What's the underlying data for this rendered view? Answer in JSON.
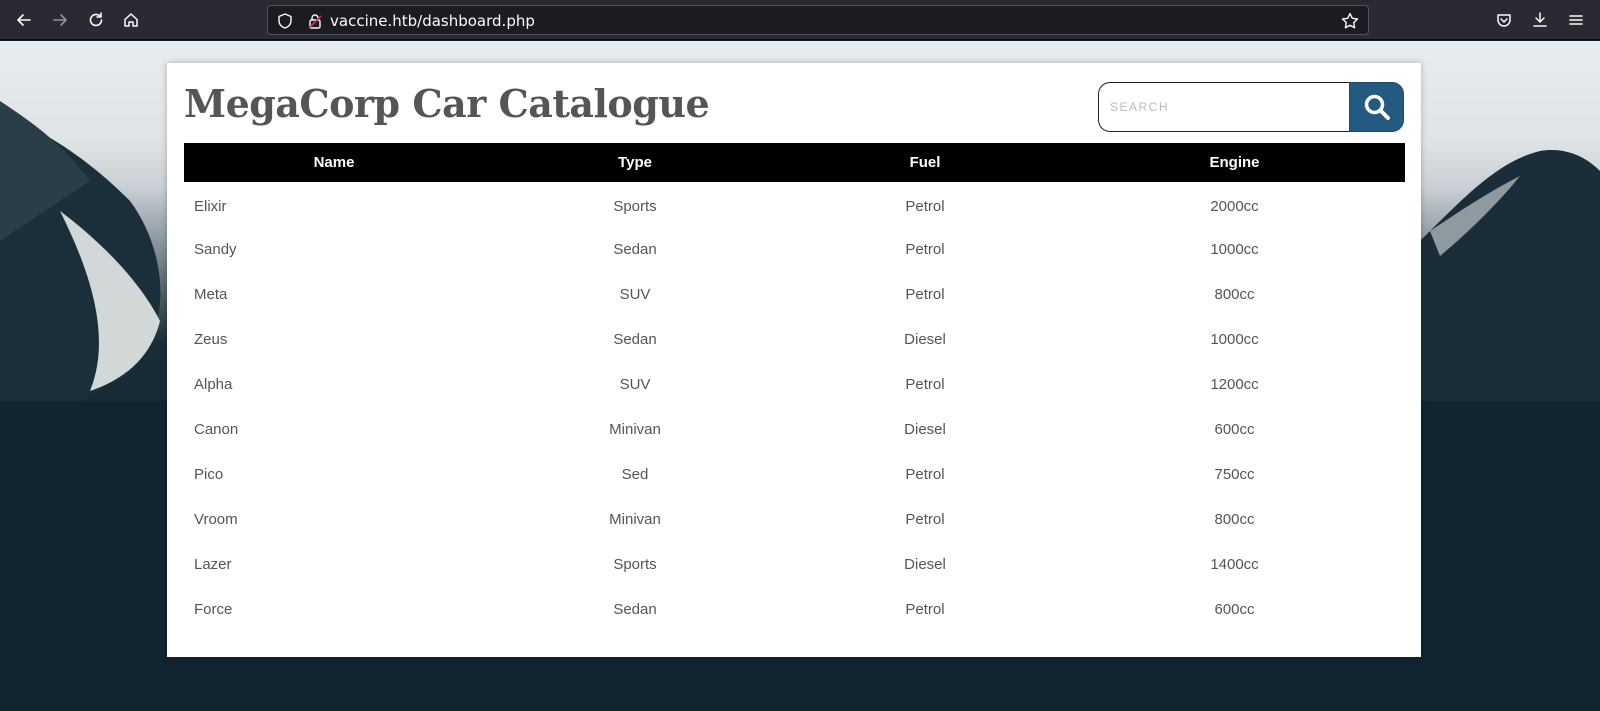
{
  "browser": {
    "url": "vaccine.htb/dashboard.php"
  },
  "page": {
    "title": "MegaCorp Car Catalogue",
    "search_placeholder": "SEARCH"
  },
  "table": {
    "headers": [
      "Name",
      "Type",
      "Fuel",
      "Engine"
    ],
    "rows": [
      [
        "Elixir",
        "Sports",
        "Petrol",
        "2000cc"
      ],
      [
        "Sandy",
        "Sedan",
        "Petrol",
        "1000cc"
      ],
      [
        "Meta",
        "SUV",
        "Petrol",
        "800cc"
      ],
      [
        "Zeus",
        "Sedan",
        "Diesel",
        "1000cc"
      ],
      [
        "Alpha",
        "SUV",
        "Petrol",
        "1200cc"
      ],
      [
        "Canon",
        "Minivan",
        "Diesel",
        "600cc"
      ],
      [
        "Pico",
        "Sed",
        "Petrol",
        "750cc"
      ],
      [
        "Vroom",
        "Minivan",
        "Petrol",
        "800cc"
      ],
      [
        "Lazer",
        "Sports",
        "Diesel",
        "1400cc"
      ],
      [
        "Force",
        "Sedan",
        "Petrol",
        "600cc"
      ]
    ]
  },
  "icons": {
    "back": "back-arrow-icon",
    "forward": "forward-arrow-icon",
    "reload": "reload-icon",
    "home": "home-icon",
    "shield": "shield-icon",
    "lock": "lock-icon",
    "bookmark": "star-icon",
    "pocket": "pocket-icon",
    "downloads": "download-icon",
    "menu": "hamburger-menu-icon",
    "search": "search-icon"
  },
  "colors": {
    "search_button": "#255a80",
    "table_header": "#000000"
  }
}
